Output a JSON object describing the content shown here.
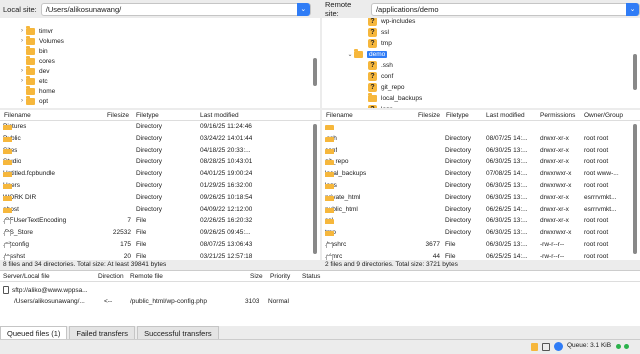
{
  "local_site": {
    "label": "Local site:",
    "path": "/Users/alikosunawang/"
  },
  "remote_site": {
    "label": "Remote site:",
    "path": "/applications/demo"
  },
  "local_tree": [
    {
      "name": "timvr",
      "expander": "›",
      "kind": "folder"
    },
    {
      "name": "Volumes",
      "expander": "›",
      "kind": "folder"
    },
    {
      "name": "bin",
      "expander": "",
      "kind": "folder"
    },
    {
      "name": "cores",
      "expander": "",
      "kind": "folder"
    },
    {
      "name": "dev",
      "expander": "›",
      "kind": "folder"
    },
    {
      "name": "etc",
      "expander": "›",
      "kind": "folder"
    },
    {
      "name": "home",
      "expander": "",
      "kind": "folder"
    },
    {
      "name": "opt",
      "expander": "›",
      "kind": "folder"
    }
  ],
  "remote_tree": [
    {
      "name": "wp-includes",
      "kind": "qfolder",
      "expander": ""
    },
    {
      "name": "ssl",
      "kind": "qfolder",
      "expander": ""
    },
    {
      "name": "tmp",
      "kind": "qfolder",
      "expander": ""
    },
    {
      "name": "demo",
      "kind": "folder",
      "expander": "⌄",
      "selected": true
    },
    {
      "name": ".ssh",
      "kind": "qfolder",
      "expander": ""
    },
    {
      "name": "conf",
      "kind": "qfolder",
      "expander": ""
    },
    {
      "name": "git_repo",
      "kind": "qfolder",
      "expander": ""
    },
    {
      "name": "local_backups",
      "kind": "folder",
      "expander": ""
    },
    {
      "name": "logs",
      "kind": "qfolder",
      "expander": ""
    }
  ],
  "local_columns": {
    "name": "Filename",
    "size": "Filesize",
    "type": "Filetype",
    "modified": "Last modified"
  },
  "local_files": [
    {
      "name": "Pictures",
      "size": "",
      "type": "Directory",
      "modified": "09/16/25 11:24:46",
      "kind": "folder"
    },
    {
      "name": "Public",
      "size": "",
      "type": "Directory",
      "modified": "03/24/22 14:01:44",
      "kind": "folder"
    },
    {
      "name": "Sites",
      "size": "",
      "type": "Directory",
      "modified": "04/18/25 20:33:...",
      "kind": "folder"
    },
    {
      "name": "Studio",
      "size": "",
      "type": "Directory",
      "modified": "08/28/25 10:43:01",
      "kind": "folder"
    },
    {
      "name": "Untitled.fcpbundle",
      "size": "",
      "type": "Directory",
      "modified": "04/01/25 19:00:24",
      "kind": "folder"
    },
    {
      "name": "Users",
      "size": "",
      "type": "Directory",
      "modified": "01/29/25 16:32:00",
      "kind": "folder"
    },
    {
      "name": "WORK DIR",
      "size": "",
      "type": "Directory",
      "modified": "09/26/25 10:18:54",
      "kind": "folder"
    },
    {
      "name": "ghost",
      "size": "",
      "type": "Directory",
      "modified": "04/09/22 12:12:00",
      "kind": "folder"
    },
    {
      "name": ".CFUserTextEncoding",
      "size": "7",
      "type": "File",
      "modified": "02/26/25 16:20:32",
      "kind": "file"
    },
    {
      "name": ".DS_Store",
      "size": "22532",
      "type": "File",
      "modified": "09/26/25 09:45:...",
      "kind": "file"
    },
    {
      "name": ".gitconfig",
      "size": "175",
      "type": "File",
      "modified": "08/07/25 13:06:43",
      "kind": "file"
    },
    {
      "name": ".lesshst",
      "size": "20",
      "type": "File",
      "modified": "03/21/25 12:57:18",
      "kind": "file"
    }
  ],
  "local_status": "8 files and 34 directories. Total size: At least 39841 bytes",
  "remote_columns": {
    "name": "Filename",
    "size": "Filesize",
    "type": "Filetype",
    "modified": "Last modified",
    "perms": "Permissions",
    "owner": "Owner/Group"
  },
  "remote_files": [
    {
      "name": "..",
      "size": "",
      "type": "",
      "modified": "",
      "perms": "",
      "owner": "",
      "kind": "folder"
    },
    {
      "name": ".ssh",
      "size": "",
      "type": "Directory",
      "modified": "08/07/25 14:...",
      "perms": "drwxr-xr-x",
      "owner": "root root",
      "kind": "folder"
    },
    {
      "name": "conf",
      "size": "",
      "type": "Directory",
      "modified": "06/30/25 13:...",
      "perms": "drwxr-xr-x",
      "owner": "root root",
      "kind": "folder"
    },
    {
      "name": "git_repo",
      "size": "",
      "type": "Directory",
      "modified": "06/30/25 13:...",
      "perms": "drwxr-xr-x",
      "owner": "root root",
      "kind": "folder"
    },
    {
      "name": "local_backups",
      "size": "",
      "type": "Directory",
      "modified": "07/08/25 14:...",
      "perms": "drwxrwxr-x",
      "owner": "root www-...",
      "kind": "folder"
    },
    {
      "name": "logs",
      "size": "",
      "type": "Directory",
      "modified": "06/30/25 13:...",
      "perms": "drwxrwxr-x",
      "owner": "root root",
      "kind": "folder"
    },
    {
      "name": "private_html",
      "size": "",
      "type": "Directory",
      "modified": "06/30/25 13:...",
      "perms": "drwxr-xr-x",
      "owner": "esrrrvmkt...",
      "kind": "folder"
    },
    {
      "name": "public_html",
      "size": "",
      "type": "Directory",
      "modified": "06/26/25 14:...",
      "perms": "drwxr-xr-x",
      "owner": "esrrrvmkt...",
      "kind": "folder"
    },
    {
      "name": "ssl",
      "size": "",
      "type": "Directory",
      "modified": "06/30/25 13:...",
      "perms": "drwxr-xr-x",
      "owner": "root root",
      "kind": "folder"
    },
    {
      "name": "tmp",
      "size": "",
      "type": "Directory",
      "modified": "06/30/25 13:...",
      "perms": "drwxrwxr-x",
      "owner": "root root",
      "kind": "folder"
    },
    {
      "name": ".bashrc",
      "size": "3677",
      "type": "File",
      "modified": "06/30/25 13:...",
      "perms": "-rw-r--r--",
      "owner": "root root",
      "kind": "file"
    },
    {
      "name": ".vimrc",
      "size": "44",
      "type": "File",
      "modified": "06/25/25 14:...",
      "perms": "-rw-r--r--",
      "owner": "root root",
      "kind": "file"
    }
  ],
  "remote_status": "2 files and 9 directories. Total size: 3721 bytes",
  "queue_columns": {
    "server": "Server/Local file",
    "direction": "Direction",
    "remote": "Remote file",
    "size": "Size",
    "priority": "Priority",
    "status": "Status"
  },
  "queue": {
    "server": "sftp://aliko@www.wppsa...",
    "local": "/Users/alikosunawang/...",
    "direction": "<--",
    "remote": "/public_html/wp-config.php",
    "size": "3103",
    "priority": "Normal"
  },
  "tabs": [
    {
      "label": "Queued files (1)",
      "active": true
    },
    {
      "label": "Failed transfers",
      "active": false
    },
    {
      "label": "Successful transfers",
      "active": false
    }
  ],
  "bottom_status": {
    "queue": "Queue: 3.1 KiB"
  }
}
